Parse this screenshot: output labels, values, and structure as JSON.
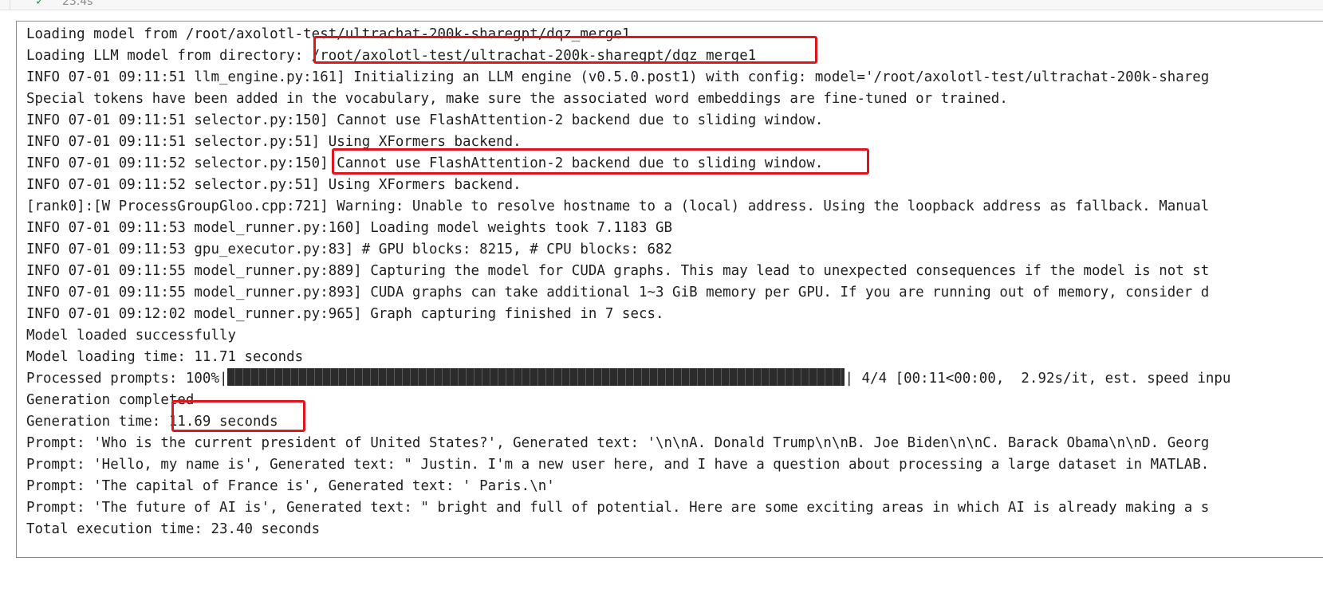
{
  "cell": {
    "status_icon": "check-icon",
    "status_glyph": "✓",
    "duration": "23.4s"
  },
  "output": {
    "lines": [
      "Loading model from /root/axolotl-test/ultrachat-200k-sharegpt/dqz_merge1",
      "Loading LLM model from directory: /root/axolotl-test/ultrachat-200k-sharegpt/dqz_merge1",
      "INFO 07-01 09:11:51 llm_engine.py:161] Initializing an LLM engine (v0.5.0.post1) with config: model='/root/axolotl-test/ultrachat-200k-shareg",
      "Special tokens have been added in the vocabulary, make sure the associated word embeddings are fine-tuned or trained.",
      "INFO 07-01 09:11:51 selector.py:150] Cannot use FlashAttention-2 backend due to sliding window.",
      "INFO 07-01 09:11:51 selector.py:51] Using XFormers backend.",
      "INFO 07-01 09:11:52 selector.py:150] Cannot use FlashAttention-2 backend due to sliding window.",
      "INFO 07-01 09:11:52 selector.py:51] Using XFormers backend.",
      "[rank0]:[W ProcessGroupGloo.cpp:721] Warning: Unable to resolve hostname to a (local) address. Using the loopback address as fallback. Manual",
      "INFO 07-01 09:11:53 model_runner.py:160] Loading model weights took 7.1183 GB",
      "INFO 07-01 09:11:53 gpu_executor.py:83] # GPU blocks: 8215, # CPU blocks: 682",
      "INFO 07-01 09:11:55 model_runner.py:889] Capturing the model for CUDA graphs. This may lead to unexpected consequences if the model is not st",
      "INFO 07-01 09:11:55 model_runner.py:893] CUDA graphs can take additional 1~3 GiB memory per GPU. If you are running out of memory, consider d",
      "INFO 07-01 09:12:02 model_runner.py:965] Graph capturing finished in 7 secs.",
      "Model loaded successfully",
      "Model loading time: 11.71 seconds"
    ],
    "progress": {
      "prefix": "Processed prompts: 100%|",
      "fraction": 1.0,
      "suffix": "| 4/4 [00:11<00:00,  2.92s/it, est. speed inpu"
    },
    "lines_after": [
      "Generation completed",
      "Generation time: 11.69 seconds",
      "Prompt: 'Who is the current president of United States?', Generated text: '\\n\\nA. Donald Trump\\n\\nB. Joe Biden\\n\\nC. Barack Obama\\n\\nD. Georg",
      "Prompt: 'Hello, my name is', Generated text: \" Justin. I'm a new user here, and I have a question about processing a large dataset in MATLAB.",
      "Prompt: 'The capital of France is', Generated text: ' Paris.\\n'",
      "Prompt: 'The future of AI is', Generated text: \" bright and full of potential. Here are some exciting areas in which AI is already making a s",
      "Total execution time: 23.40 seconds"
    ]
  },
  "annotations": {
    "color": "#e2151e"
  }
}
